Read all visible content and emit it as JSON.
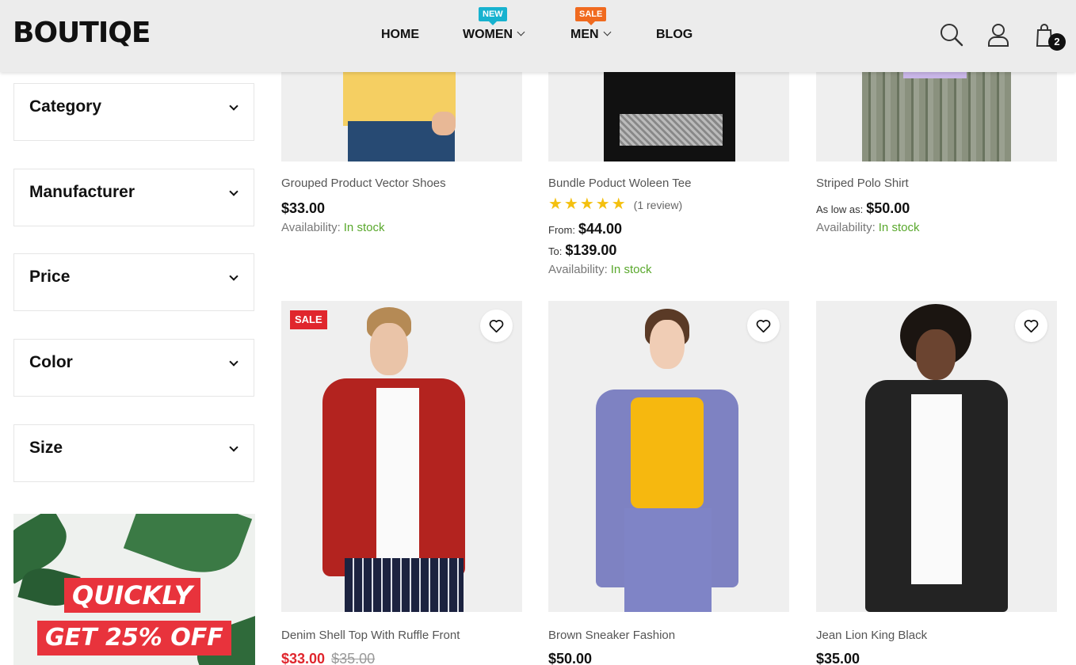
{
  "header": {
    "logo": "BOUTIQE",
    "nav": [
      {
        "label": "HOME"
      },
      {
        "label": "WOMEN",
        "badge": "NEW"
      },
      {
        "label": "MEN",
        "badge": "SALE"
      },
      {
        "label": "BLOG"
      }
    ],
    "cart_count": "2"
  },
  "sidebar": {
    "filters": [
      "Category",
      "Manufacturer",
      "Price",
      "Color",
      "Size"
    ],
    "promo": {
      "line1": "QUICKLY",
      "line2": "GET 25% OFF"
    }
  },
  "products_top": [
    {
      "name": "Grouped Product Vector Shoes",
      "price": "$33.00",
      "avail_label": "Availability:",
      "avail_value": "In stock"
    },
    {
      "name": "Bundle Poduct Woleen Tee",
      "review": "(1 review)",
      "from_label": "From:",
      "from_price": "$44.00",
      "to_label": "To:",
      "to_price": "$139.00",
      "avail_label": "Availability:",
      "avail_value": "In stock"
    },
    {
      "name": "Striped Polo Shirt",
      "prefix": "As low as:",
      "price": "$50.00",
      "avail_label": "Availability:",
      "avail_value": "In stock"
    }
  ],
  "products_bottom": [
    {
      "name": "Denim Shell Top With Ruffle Front",
      "price": "$33.00",
      "old_price": "$35.00",
      "tag": "SALE"
    },
    {
      "name": "Brown Sneaker Fashion",
      "price": "$50.00"
    },
    {
      "name": "Jean Lion King Black",
      "price": "$35.00"
    }
  ],
  "colors": {
    "accent_new": "#17b2cf",
    "accent_sale": "#f06a1f",
    "in_stock": "#59a82c",
    "sale_red": "#e0262d",
    "star": "#f4c00f"
  }
}
